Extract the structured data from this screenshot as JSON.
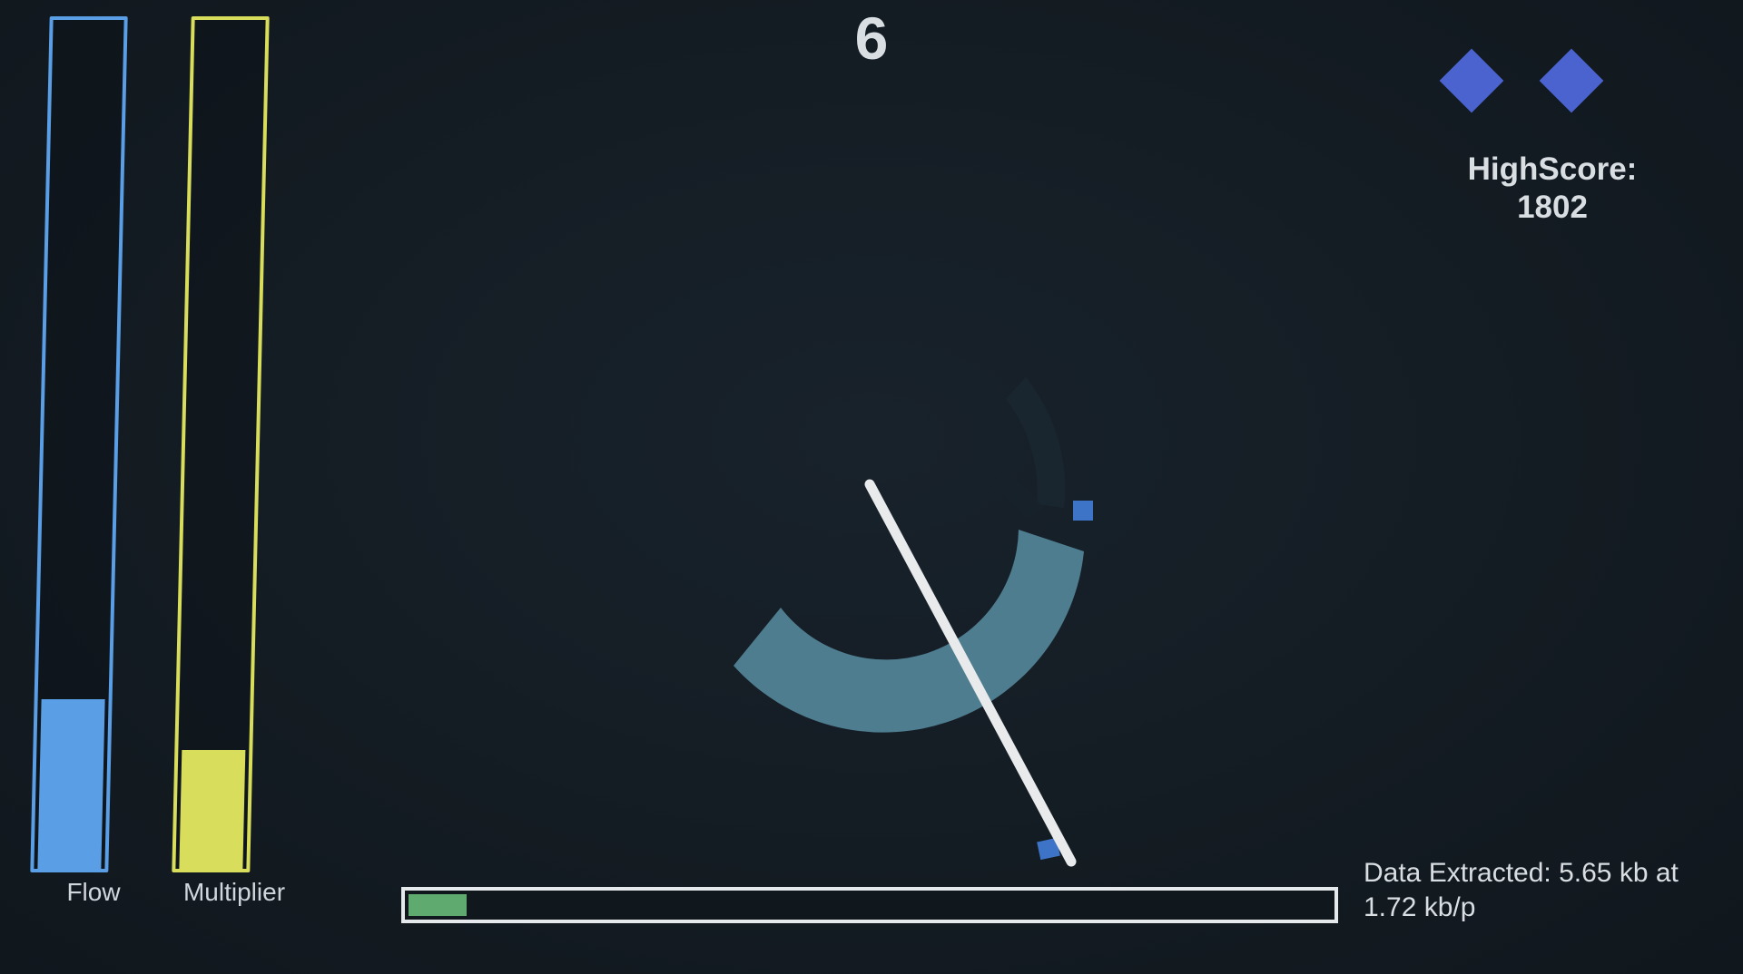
{
  "score": "6",
  "meters": {
    "flow": {
      "label": "Flow",
      "level": 0.2,
      "color": "#5a9ee6"
    },
    "multiplier": {
      "label": "Multiplier",
      "level": 0.14,
      "color": "#d8dd5c"
    }
  },
  "lives": {
    "count": 2,
    "color": "#4a63cf"
  },
  "highscore": {
    "label": "HighScore:",
    "value": "1802"
  },
  "data_extracted": {
    "line1": "Data Extracted: 5.65 kb at",
    "line2": "1.72 kb/p"
  },
  "progress": {
    "level": 0.07,
    "color": "#5faa6f"
  },
  "colors": {
    "background": "#131b22",
    "arc": "#4f7d90",
    "arc_dim": "#1b2730",
    "paddle": "#e8eaec",
    "packet": "#3d74c7"
  }
}
